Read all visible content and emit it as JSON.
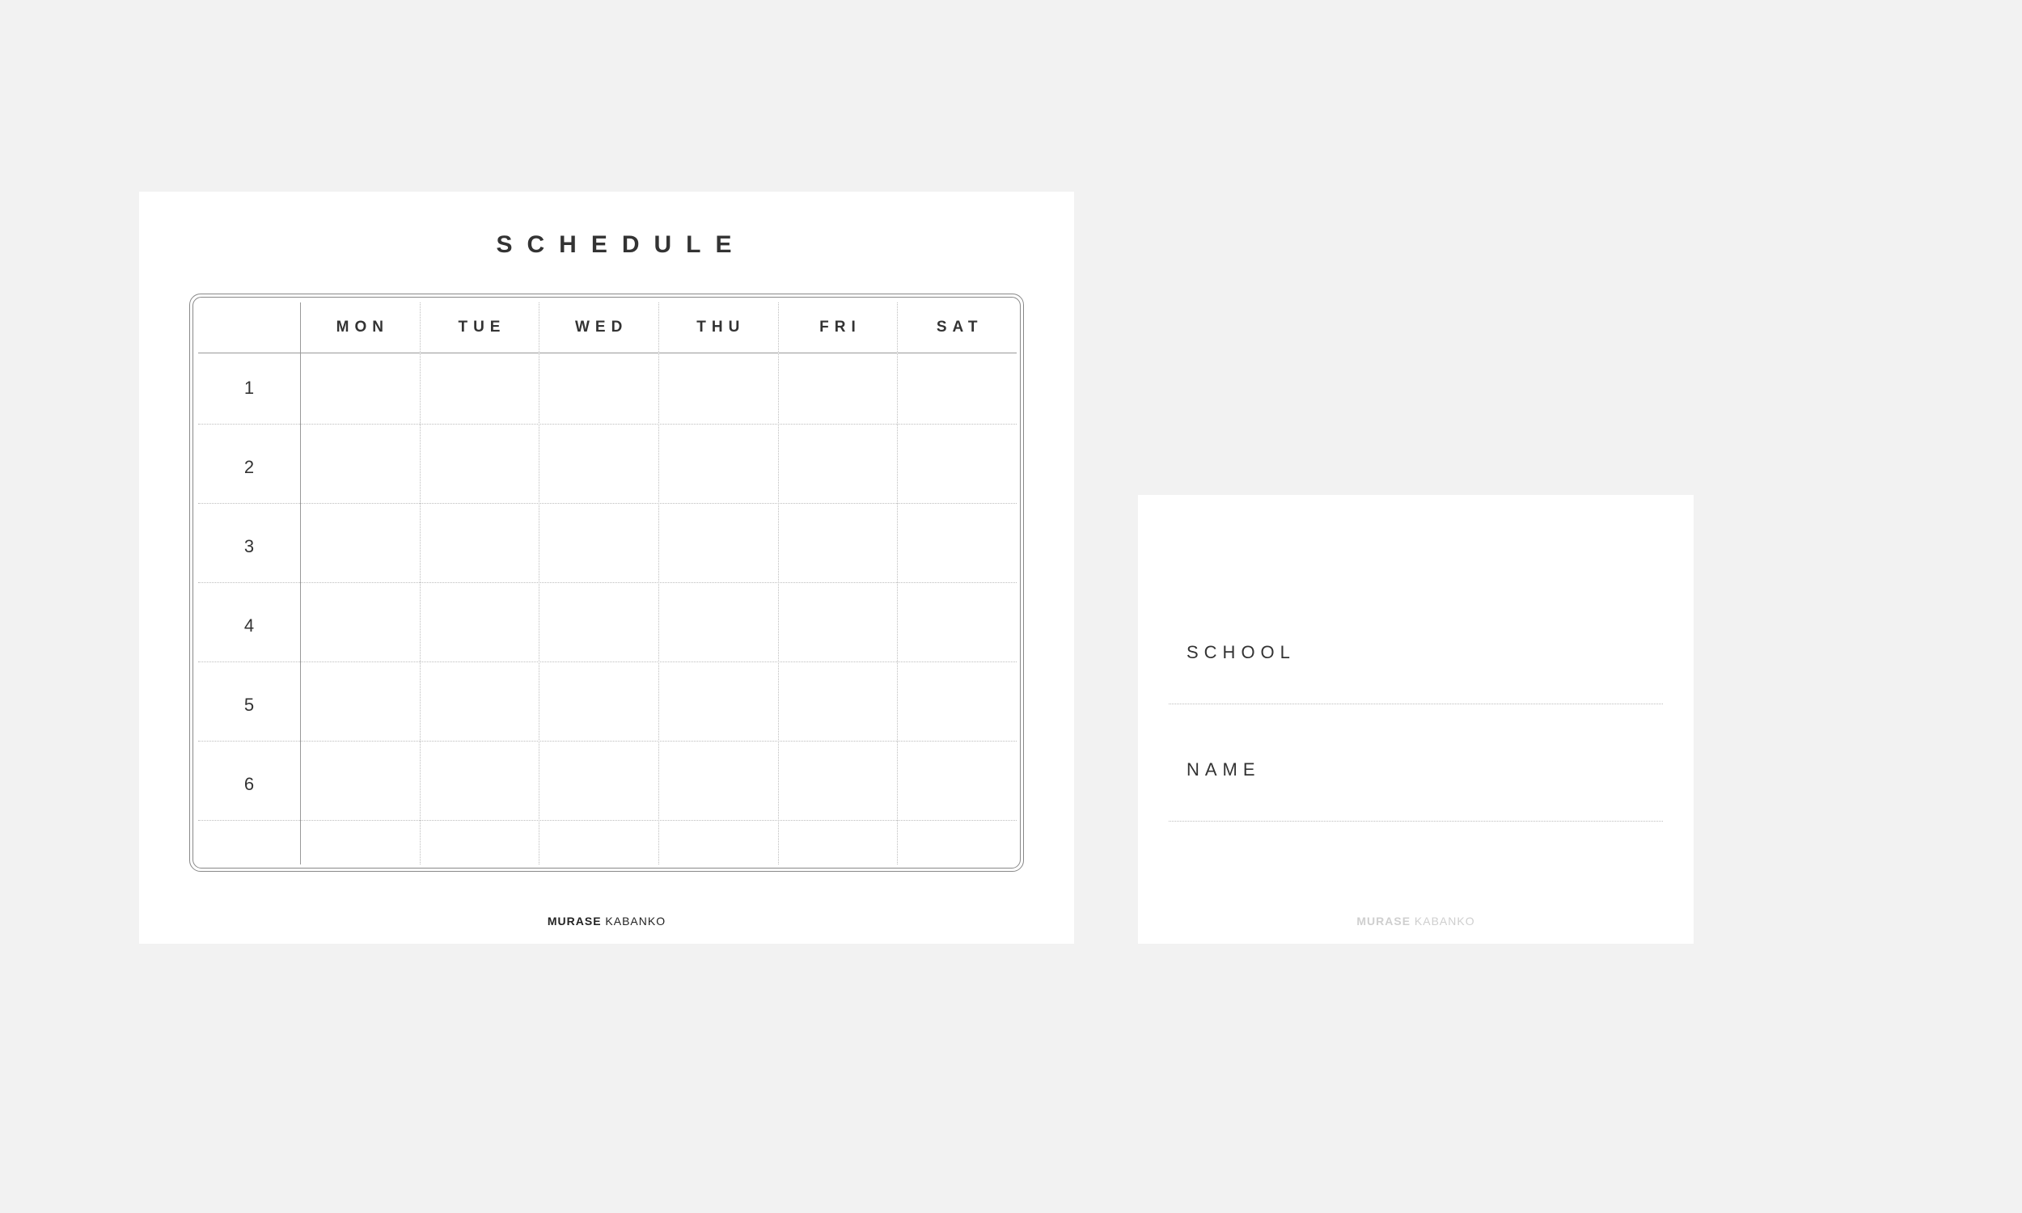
{
  "schedule_card": {
    "title": "SCHEDULE",
    "days": [
      "MON",
      "TUE",
      "WED",
      "THU",
      "FRI",
      "SAT"
    ],
    "periods": [
      "1",
      "2",
      "3",
      "4",
      "5",
      "6"
    ],
    "brand_bold": "MURASE",
    "brand_rest": " KABANKO"
  },
  "name_card": {
    "labels": {
      "school": "SCHOOL",
      "name": "NAME"
    },
    "brand_bold": "MURASE",
    "brand_rest": " KABANKO"
  }
}
